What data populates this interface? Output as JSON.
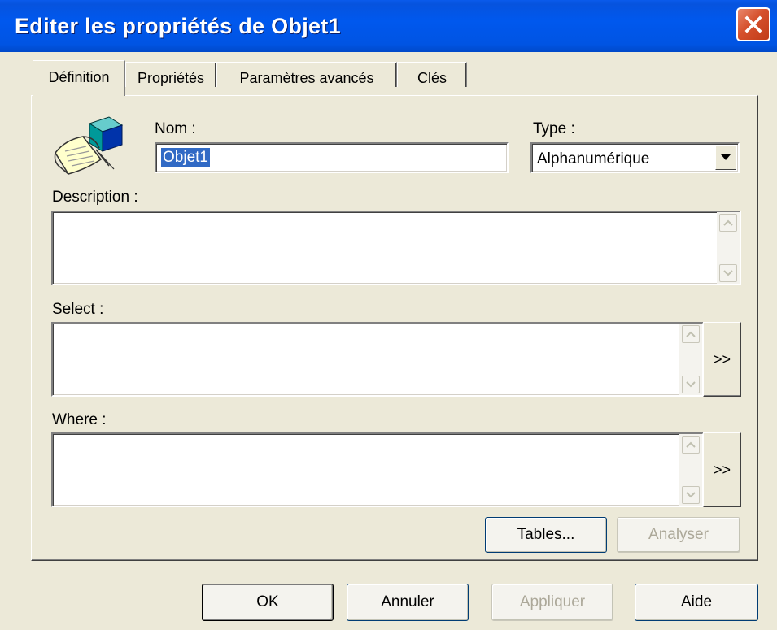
{
  "window": {
    "title": "Editer les propriétés de Objet1"
  },
  "tabs": [
    {
      "label": "Définition",
      "active": true
    },
    {
      "label": "Propriétés",
      "active": false
    },
    {
      "label": "Paramètres avancés",
      "active": false
    },
    {
      "label": "Clés",
      "active": false
    }
  ],
  "definition": {
    "icon": "object-properties-icon",
    "name_label": "Nom :",
    "name_value": "Objet1",
    "type_label": "Type :",
    "type_value": "Alphanumérique",
    "description_label": "Description :",
    "description_value": "",
    "select_label": "Select :",
    "select_value": "",
    "select_expand": ">>",
    "where_label": "Where :",
    "where_value": "",
    "where_expand": ">>",
    "tables_button": "Tables...",
    "analyze_button": "Analyser"
  },
  "footer": {
    "ok": "OK",
    "cancel": "Annuler",
    "apply": "Appliquer",
    "help": "Aide"
  },
  "colors": {
    "face": "#ECE9D8",
    "titlebar": "#0054E3",
    "selection": "#316AC5",
    "close": "#D5502C",
    "disabled_text": "#ACA899"
  }
}
